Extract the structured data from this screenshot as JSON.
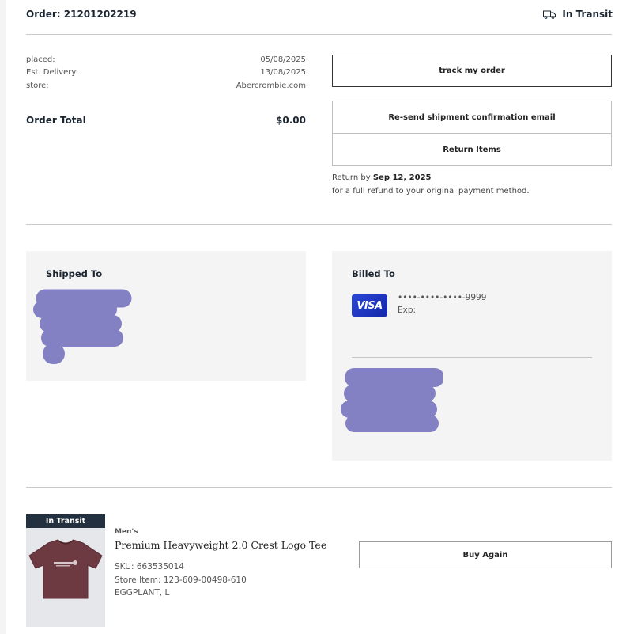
{
  "order": {
    "title": "Order: 21201202219",
    "status": "In Transit",
    "placed_label": "placed:",
    "placed_value": "05/08/2025",
    "delivery_label": "Est. Delivery:",
    "delivery_value": "13/08/2025",
    "store_label": "store:",
    "store_value": "Abercrombie.com",
    "total_label": "Order Total",
    "total_value": "$0.00"
  },
  "actions": {
    "track": "track my order",
    "resend": "Re-send shipment confirmation email",
    "return_items": "Return Items"
  },
  "return_info": {
    "prefix": "Return by",
    "date": "Sep 12, 2025",
    "note": "for a full refund to your original payment method."
  },
  "shipped_to": {
    "title": "Shipped To"
  },
  "billed_to": {
    "title": "Billed To",
    "card_brand": "VISA",
    "card_number": "••••-••••-••••-9999",
    "exp_label": "Exp:"
  },
  "item": {
    "badge": "In Transit",
    "category": "Men's",
    "name": "Premium Heavyweight 2.0 Crest Logo Tee",
    "sku": "SKU: 663535014",
    "store_item": "Store Item: 123-609-00498-610",
    "variant": "EGGPLANT, L",
    "buy_again": "Buy Again"
  },
  "colors": {
    "redaction": "#8380c4",
    "card_bg": "#f4f4f4",
    "badge_bg": "#223040",
    "shirt": "#6d3a42"
  },
  "icons": {
    "status": "truck-icon",
    "payment": "visa-logo"
  }
}
